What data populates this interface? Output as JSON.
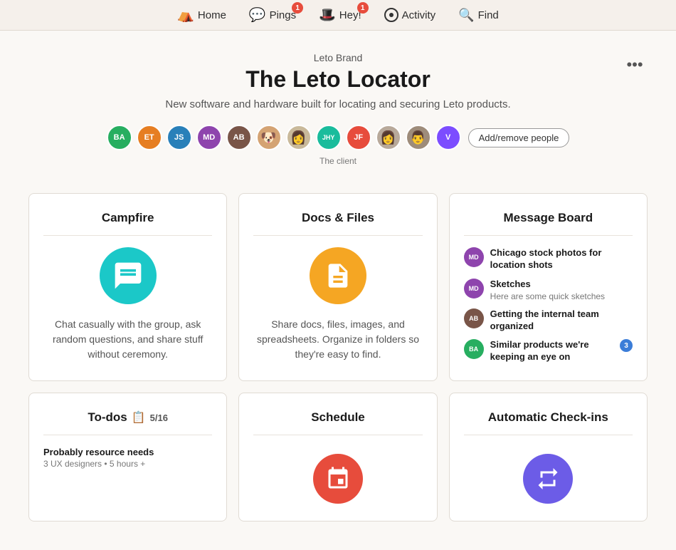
{
  "nav": {
    "items": [
      {
        "label": "Home",
        "icon": "🏠",
        "badge": null
      },
      {
        "label": "Pings",
        "icon": "💬",
        "badge": "1"
      },
      {
        "label": "Hey!",
        "icon": "👋",
        "badge": "1"
      },
      {
        "label": "Activity",
        "icon": "◉",
        "badge": null
      },
      {
        "label": "Find",
        "icon": "🔍",
        "badge": null
      }
    ]
  },
  "header": {
    "brand": "Leto Brand",
    "title": "The Leto Locator",
    "description": "New software and hardware built for locating and securing Leto products.",
    "more_button_label": "•••",
    "add_people_label": "Add/remove people",
    "the_client_label": "The client"
  },
  "avatars": [
    {
      "initials": "BA",
      "color": "av-green",
      "type": "initials"
    },
    {
      "initials": "ET",
      "color": "av-orange",
      "type": "initials"
    },
    {
      "initials": "JS",
      "color": "av-blue",
      "type": "initials"
    },
    {
      "initials": "MD",
      "color": "av-purple",
      "type": "initials"
    },
    {
      "initials": "AB",
      "color": "av-brown",
      "type": "initials"
    },
    {
      "initials": "",
      "color": "",
      "type": "photo",
      "emoji": "🐶"
    },
    {
      "initials": "",
      "color": "",
      "type": "photo",
      "emoji": "👩"
    },
    {
      "initials": "JHY",
      "color": "av-teal",
      "type": "initials"
    },
    {
      "initials": "JF",
      "color": "av-red",
      "type": "initials"
    },
    {
      "initials": "",
      "color": "",
      "type": "photo",
      "emoji": "👩"
    },
    {
      "initials": "",
      "color": "",
      "type": "photo",
      "emoji": "👨"
    },
    {
      "initials": "V",
      "color": "av-violet",
      "type": "initials"
    }
  ],
  "campfire": {
    "title": "Campfire",
    "description": "Chat casually with the group, ask random questions, and share stuff without ceremony."
  },
  "docs": {
    "title": "Docs & Files",
    "description": "Share docs, files, images, and spreadsheets. Organize in folders so they're easy to find."
  },
  "message_board": {
    "title": "Message Board",
    "items": [
      {
        "initials": "MD",
        "color": "av-purple",
        "title": "Chicago stock photos for location shots",
        "sub": ""
      },
      {
        "initials": "MD",
        "color": "av-purple",
        "title": "Sketches",
        "sub": "Here are some quick sketches"
      },
      {
        "initials": "AB",
        "color": "av-brown",
        "title": "Getting the internal team organized",
        "sub": ""
      },
      {
        "initials": "BA",
        "color": "av-green",
        "title": "Similar products we're keeping an eye on",
        "sub": "",
        "badge": "3"
      }
    ]
  },
  "todos": {
    "title": "To-dos",
    "count": "5/16",
    "todo_title": "Probably resource needs",
    "todo_sub": "3 UX designers • 5 hours +"
  },
  "schedule": {
    "title": "Schedule"
  },
  "checkins": {
    "title": "Automatic Check-ins"
  }
}
